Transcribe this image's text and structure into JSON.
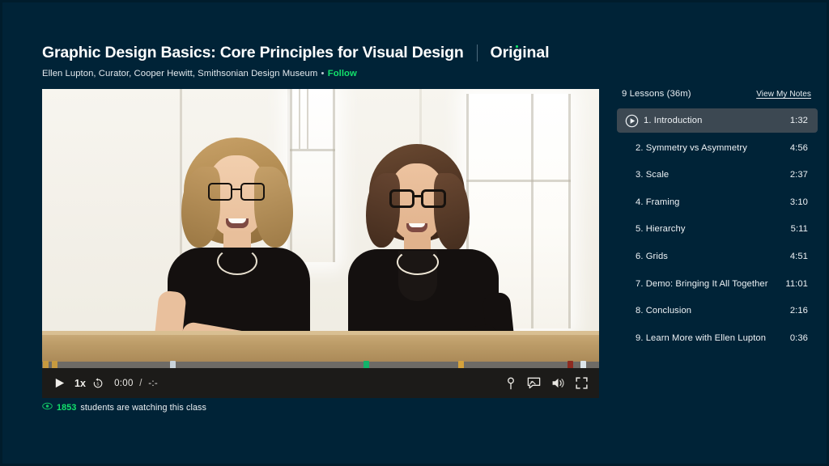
{
  "theme": {
    "background": "#002337",
    "accent_green": "#12e16b",
    "active_row": "#3c4852",
    "control_bar": "#1c1b19"
  },
  "header": {
    "title": "Graphic Design Basics: Core Principles for Visual Design",
    "badge": "Original",
    "byline": "Ellen Lupton, Curator, Cooper Hewitt, Smithsonian Design Museum",
    "byline_separator": "•",
    "follow_label": "Follow"
  },
  "player": {
    "play_label": "Play",
    "speed_label": "1x",
    "replay_label": "Replay 10 seconds",
    "current_time": "0:00",
    "time_separator": "/",
    "total_time": "-:-",
    "progress_percent": 0,
    "icons": {
      "play": "play-icon",
      "replay": "replay-icon",
      "marker": "pin-marker-icon",
      "notes": "notes-icon",
      "volume": "volume-icon",
      "fullscreen": "fullscreen-icon"
    },
    "chapter_markers": [
      {
        "position_percent": 0.6,
        "color": "#c79a3f"
      },
      {
        "position_percent": 2.2,
        "color": "#c79a3f"
      },
      {
        "position_percent": 23.4,
        "color": "#c9d3da"
      },
      {
        "position_percent": 58.2,
        "color": "#12b369"
      },
      {
        "position_percent": 75.1,
        "color": "#d5a23c"
      },
      {
        "position_percent": 94.7,
        "color": "#8d2b20"
      },
      {
        "position_percent": 97.1,
        "color": "#dce5ea"
      }
    ]
  },
  "watching": {
    "icon": "eye-icon",
    "count": "1853",
    "text": "students are watching this class"
  },
  "lessons_panel": {
    "count_label": "9 Lessons (36m)",
    "notes_link": "View My Notes",
    "items": [
      {
        "title": "1. Introduction",
        "duration": "1:32",
        "active": true
      },
      {
        "title": "2. Symmetry vs Asymmetry",
        "duration": "4:56",
        "active": false
      },
      {
        "title": "3. Scale",
        "duration": "2:37",
        "active": false
      },
      {
        "title": "4. Framing",
        "duration": "3:10",
        "active": false
      },
      {
        "title": "5. Hierarchy",
        "duration": "5:11",
        "active": false
      },
      {
        "title": "6. Grids",
        "duration": "4:51",
        "active": false
      },
      {
        "title": "7. Demo: Bringing It All Together",
        "duration": "11:01",
        "active": false
      },
      {
        "title": "8. Conclusion",
        "duration": "2:16",
        "active": false
      },
      {
        "title": "9. Learn More with Ellen Lupton",
        "duration": "0:36",
        "active": false
      }
    ]
  }
}
